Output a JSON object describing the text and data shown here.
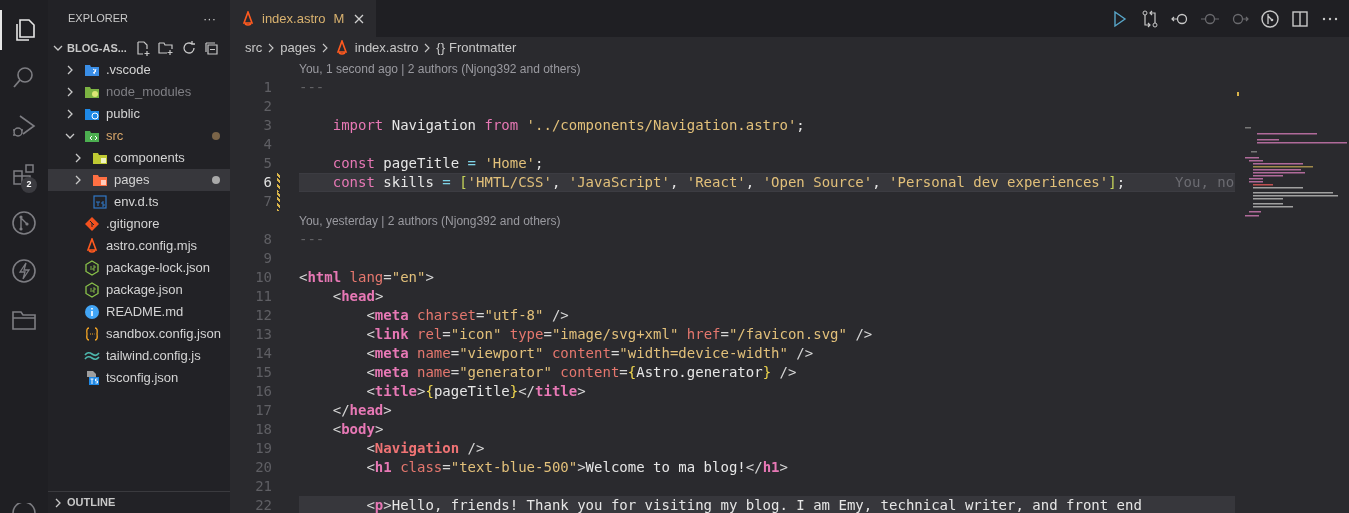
{
  "activity_bar": {
    "items": [
      {
        "kind": "files",
        "selected": true
      },
      {
        "kind": "search",
        "selected": false
      },
      {
        "kind": "debug",
        "selected": false
      },
      {
        "kind": "extensions",
        "selected": false,
        "badge": "2"
      },
      {
        "kind": "git",
        "selected": false
      },
      {
        "kind": "bolt",
        "selected": false
      },
      {
        "kind": "folder",
        "selected": false
      }
    ]
  },
  "sidebar": {
    "title": "EXPLORER",
    "more": "···",
    "project": "BLOG-AS...",
    "project_expanded": true,
    "tree": [
      {
        "label": ".vscode",
        "kind": "vscode-folder",
        "expanded": false,
        "selected": false,
        "modified": false,
        "ignored": false
      },
      {
        "label": "node_modules",
        "kind": "node-folder",
        "expanded": false,
        "selected": false,
        "modified": false,
        "ignored": true
      },
      {
        "label": "public",
        "kind": "public-folder",
        "expanded": false,
        "selected": false,
        "modified": false,
        "ignored": false
      },
      {
        "label": "src",
        "kind": "src-folder",
        "expanded": true,
        "selected": false,
        "modified": true,
        "ignored": false,
        "children": [
          {
            "label": "components",
            "kind": "components-folder",
            "expanded": false,
            "selected": false,
            "modified": false,
            "ignored": false
          },
          {
            "label": "pages",
            "kind": "pages-folder",
            "expanded": false,
            "selected": true,
            "modified": true,
            "ignored": false
          },
          {
            "label": "env.d.ts",
            "kind": "typescript",
            "selected": false,
            "modified": false,
            "ignored": false
          }
        ]
      },
      {
        "label": ".gitignore",
        "kind": "git",
        "selected": false,
        "modified": false,
        "ignored": false
      },
      {
        "label": "astro.config.mjs",
        "kind": "astro",
        "selected": false,
        "modified": false,
        "ignored": false
      },
      {
        "label": "package-lock.json",
        "kind": "node",
        "selected": false,
        "modified": false,
        "ignored": false
      },
      {
        "label": "package.json",
        "kind": "node",
        "selected": false,
        "modified": false,
        "ignored": false
      },
      {
        "label": "README.md",
        "kind": "info",
        "selected": false,
        "modified": false,
        "ignored": false
      },
      {
        "label": "sandbox.config.json",
        "kind": "json",
        "selected": false,
        "modified": false,
        "ignored": false
      },
      {
        "label": "tailwind.config.js",
        "kind": "tailwind",
        "selected": false,
        "modified": false,
        "ignored": false
      },
      {
        "label": "tsconfig.json",
        "kind": "tsconfig",
        "selected": false,
        "modified": false,
        "ignored": false
      }
    ],
    "outline": {
      "label": "OUTLINE",
      "expanded": false
    }
  },
  "tabs": [
    {
      "label": "index.astro",
      "status": "M",
      "selected": true
    }
  ],
  "breadcrumbs": [
    {
      "kind": "folder",
      "label": "src"
    },
    {
      "kind": "folder",
      "label": "pages"
    },
    {
      "kind": "astro",
      "label": "index.astro"
    },
    {
      "kind": "symbol",
      "icon_text": "{}",
      "label": "Frontmatter"
    }
  ],
  "editor_rows": [
    {
      "kind": "lens",
      "text": "You, 1 second ago | 2 authors (Njong392 and others)"
    },
    {
      "kind": "line",
      "number": "1",
      "current": false,
      "highlighted": false,
      "changed": false,
      "tokens": [
        {
          "kind": "dim",
          "text": "---"
        }
      ]
    },
    {
      "kind": "line",
      "number": "2",
      "current": false,
      "highlighted": false,
      "changed": false,
      "tokens": []
    },
    {
      "kind": "line",
      "number": "3",
      "current": false,
      "highlighted": false,
      "changed": false,
      "tokens": [
        {
          "kind": "keyword",
          "text": "    import"
        },
        {
          "kind": "plain",
          "text": " Navigation "
        },
        {
          "kind": "keyword",
          "text": "from"
        },
        {
          "kind": "string",
          "text": " '../components/Navigation.astro'"
        },
        {
          "kind": "plain",
          "text": ";"
        }
      ]
    },
    {
      "kind": "line",
      "number": "4",
      "current": false,
      "highlighted": false,
      "changed": false,
      "tokens": []
    },
    {
      "kind": "line",
      "number": "5",
      "current": false,
      "highlighted": false,
      "changed": false,
      "tokens": [
        {
          "kind": "keyword",
          "text": "    const"
        },
        {
          "kind": "plain",
          "text": " pageTitle "
        },
        {
          "kind": "operator",
          "text": "="
        },
        {
          "kind": "string",
          "text": " 'Home'"
        },
        {
          "kind": "plain",
          "text": ";"
        }
      ]
    },
    {
      "kind": "line",
      "number": "6",
      "current": true,
      "highlighted": true,
      "changed": true,
      "blame": "You, no",
      "tokens": [
        {
          "kind": "keyword",
          "text": "    const"
        },
        {
          "kind": "plain",
          "text": " skills "
        },
        {
          "kind": "operator",
          "text": "="
        },
        {
          "kind": "bracket",
          "text": " ["
        },
        {
          "kind": "string",
          "text": "'HMTL/CSS'"
        },
        {
          "kind": "plain",
          "text": ", "
        },
        {
          "kind": "string",
          "text": "'JavaScript'"
        },
        {
          "kind": "plain",
          "text": ", "
        },
        {
          "kind": "string",
          "text": "'React'"
        },
        {
          "kind": "plain",
          "text": ", "
        },
        {
          "kind": "string",
          "text": "'Open Source'"
        },
        {
          "kind": "plain",
          "text": ", "
        },
        {
          "kind": "string",
          "text": "'Personal dev experiences'"
        },
        {
          "kind": "bracket",
          "text": "]"
        },
        {
          "kind": "plain",
          "text": ";"
        }
      ]
    },
    {
      "kind": "line",
      "number": "7",
      "current": false,
      "highlighted": false,
      "changed": true,
      "tokens": []
    },
    {
      "kind": "lens",
      "text": "You, yesterday | 2 authors (Njong392 and others)"
    },
    {
      "kind": "line",
      "number": "8",
      "current": false,
      "highlighted": false,
      "changed": false,
      "tokens": [
        {
          "kind": "dim",
          "text": "---"
        }
      ]
    },
    {
      "kind": "line",
      "number": "9",
      "current": false,
      "highlighted": false,
      "changed": false,
      "tokens": []
    },
    {
      "kind": "line",
      "number": "10",
      "current": false,
      "highlighted": false,
      "changed": false,
      "tokens": [
        {
          "kind": "punct",
          "text": "<"
        },
        {
          "kind": "tag",
          "text": "html"
        },
        {
          "kind": "attr",
          "text": " lang"
        },
        {
          "kind": "punct",
          "text": "="
        },
        {
          "kind": "string",
          "text": "\"en\""
        },
        {
          "kind": "punct",
          "text": ">"
        }
      ]
    },
    {
      "kind": "line",
      "number": "11",
      "current": false,
      "highlighted": false,
      "changed": false,
      "tokens": [
        {
          "kind": "punct",
          "text": "    <"
        },
        {
          "kind": "tag",
          "text": "head"
        },
        {
          "kind": "punct",
          "text": ">"
        }
      ]
    },
    {
      "kind": "line",
      "number": "12",
      "current": false,
      "highlighted": false,
      "changed": false,
      "tokens": [
        {
          "kind": "punct",
          "text": "        <"
        },
        {
          "kind": "tag",
          "text": "meta"
        },
        {
          "kind": "attr",
          "text": " charset"
        },
        {
          "kind": "punct",
          "text": "="
        },
        {
          "kind": "string",
          "text": "\"utf-8\""
        },
        {
          "kind": "punct",
          "text": " />"
        }
      ]
    },
    {
      "kind": "line",
      "number": "13",
      "current": false,
      "highlighted": false,
      "changed": false,
      "tokens": [
        {
          "kind": "punct",
          "text": "        <"
        },
        {
          "kind": "tag",
          "text": "link"
        },
        {
          "kind": "attr",
          "text": " rel"
        },
        {
          "kind": "punct",
          "text": "="
        },
        {
          "kind": "string",
          "text": "\"icon\""
        },
        {
          "kind": "attr",
          "text": " type"
        },
        {
          "kind": "punct",
          "text": "="
        },
        {
          "kind": "string",
          "text": "\"image/svg+xml\""
        },
        {
          "kind": "attr",
          "text": " href"
        },
        {
          "kind": "punct",
          "text": "="
        },
        {
          "kind": "string",
          "text": "\"/favicon.svg\""
        },
        {
          "kind": "punct",
          "text": " />"
        }
      ]
    },
    {
      "kind": "line",
      "number": "14",
      "current": false,
      "highlighted": false,
      "changed": false,
      "tokens": [
        {
          "kind": "punct",
          "text": "        <"
        },
        {
          "kind": "tag",
          "text": "meta"
        },
        {
          "kind": "attr",
          "text": " name"
        },
        {
          "kind": "punct",
          "text": "="
        },
        {
          "kind": "string",
          "text": "\"viewport\""
        },
        {
          "kind": "attr",
          "text": " content"
        },
        {
          "kind": "punct",
          "text": "="
        },
        {
          "kind": "string",
          "text": "\"width=device-width\""
        },
        {
          "kind": "punct",
          "text": " />"
        }
      ]
    },
    {
      "kind": "line",
      "number": "15",
      "current": false,
      "highlighted": false,
      "changed": false,
      "tokens": [
        {
          "kind": "punct",
          "text": "        <"
        },
        {
          "kind": "tag",
          "text": "meta"
        },
        {
          "kind": "attr",
          "text": " name"
        },
        {
          "kind": "punct",
          "text": "="
        },
        {
          "kind": "string",
          "text": "\"generator\""
        },
        {
          "kind": "attr",
          "text": " content"
        },
        {
          "kind": "punct",
          "text": "="
        },
        {
          "kind": "brace",
          "text": "{"
        },
        {
          "kind": "plain",
          "text": "Astro.generator"
        },
        {
          "kind": "brace",
          "text": "}"
        },
        {
          "kind": "punct",
          "text": " />"
        }
      ]
    },
    {
      "kind": "line",
      "number": "16",
      "current": false,
      "highlighted": false,
      "changed": false,
      "tokens": [
        {
          "kind": "punct",
          "text": "        <"
        },
        {
          "kind": "tag",
          "text": "title"
        },
        {
          "kind": "punct",
          "text": ">"
        },
        {
          "kind": "brace",
          "text": "{"
        },
        {
          "kind": "plain",
          "text": "pageTitle"
        },
        {
          "kind": "brace",
          "text": "}"
        },
        {
          "kind": "punct",
          "text": "</"
        },
        {
          "kind": "tag",
          "text": "title"
        },
        {
          "kind": "punct",
          "text": ">"
        }
      ]
    },
    {
      "kind": "line",
      "number": "17",
      "current": false,
      "highlighted": false,
      "changed": false,
      "tokens": [
        {
          "kind": "punct",
          "text": "    </"
        },
        {
          "kind": "tag",
          "text": "head"
        },
        {
          "kind": "punct",
          "text": ">"
        }
      ]
    },
    {
      "kind": "line",
      "number": "18",
      "current": false,
      "highlighted": false,
      "changed": false,
      "tokens": [
        {
          "kind": "punct",
          "text": "    <"
        },
        {
          "kind": "tag",
          "text": "body"
        },
        {
          "kind": "punct",
          "text": ">"
        }
      ]
    },
    {
      "kind": "line",
      "number": "19",
      "current": false,
      "highlighted": false,
      "changed": false,
      "tokens": [
        {
          "kind": "punct",
          "text": "        <"
        },
        {
          "kind": "component",
          "text": "Navigation"
        },
        {
          "kind": "punct",
          "text": " />"
        }
      ]
    },
    {
      "kind": "line",
      "number": "20",
      "current": false,
      "highlighted": false,
      "changed": false,
      "tokens": [
        {
          "kind": "punct",
          "text": "        <"
        },
        {
          "kind": "tag",
          "text": "h1"
        },
        {
          "kind": "attr",
          "text": " class"
        },
        {
          "kind": "punct",
          "text": "="
        },
        {
          "kind": "string",
          "text": "\"text-blue-500\""
        },
        {
          "kind": "punct",
          "text": ">"
        },
        {
          "kind": "plain",
          "text": "Welcome to ma blog!"
        },
        {
          "kind": "punct",
          "text": "</"
        },
        {
          "kind": "tag",
          "text": "h1"
        },
        {
          "kind": "punct",
          "text": ">"
        }
      ]
    },
    {
      "kind": "line",
      "number": "21",
      "current": false,
      "highlighted": false,
      "changed": false,
      "tokens": []
    },
    {
      "kind": "line",
      "number": "22",
      "current": false,
      "highlighted": true,
      "changed": false,
      "tokens": [
        {
          "kind": "punct",
          "text": "        <"
        },
        {
          "kind": "tag",
          "text": "p"
        },
        {
          "kind": "punct",
          "text": ">"
        },
        {
          "kind": "plain",
          "text": "Hello, friends! Thank you for visiting my blog. I am Emy, technical writer, and front end"
        }
      ]
    }
  ]
}
